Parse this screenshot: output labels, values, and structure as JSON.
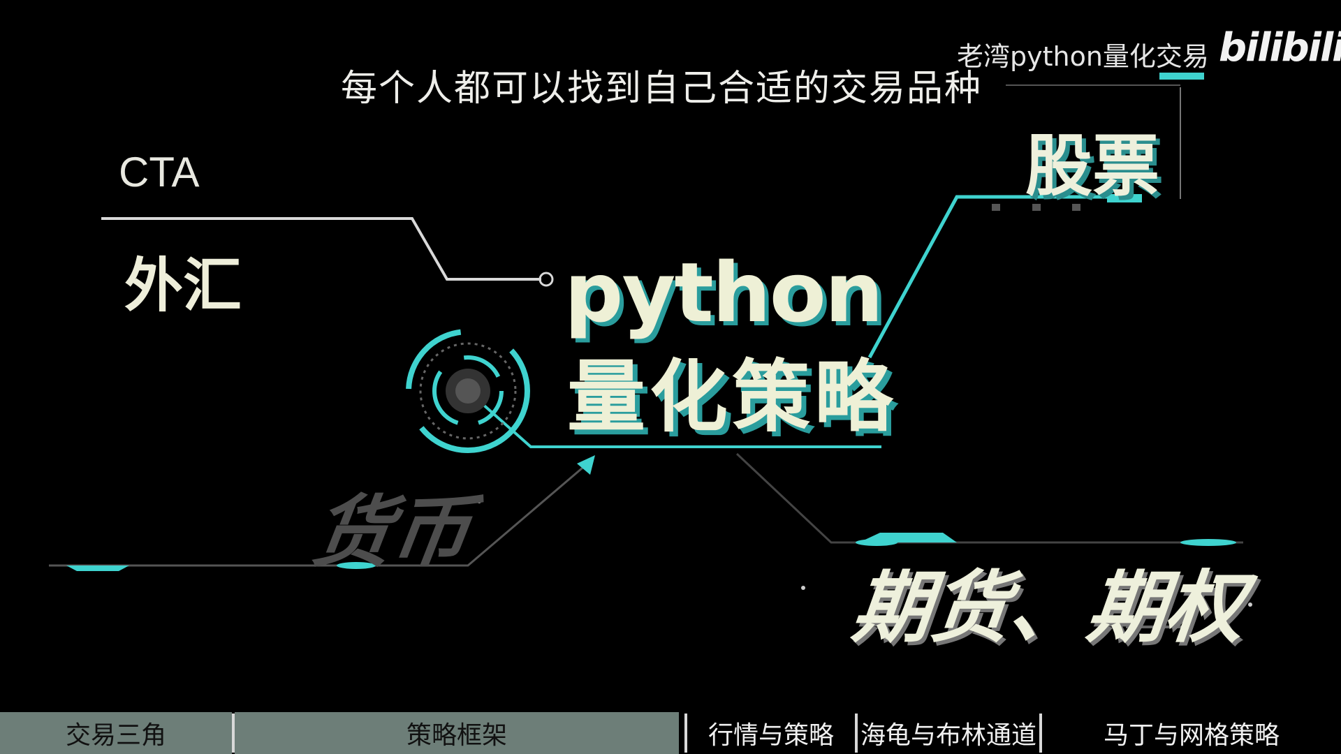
{
  "subtitle": "每个人都可以找到自己合适的交易品种",
  "watermark": {
    "text": "老湾python量化交易",
    "logo": "bilibili"
  },
  "labels": {
    "cta": "CTA",
    "forex": "外汇",
    "stocks": "股票",
    "title_en": "python",
    "title_cn": "量化策略",
    "currency": "货币",
    "futures_options": "期货、期权"
  },
  "nav": [
    {
      "label": "交易三角",
      "active": true
    },
    {
      "label": "策略框架",
      "active": true
    },
    {
      "label": "行情与策略",
      "active": false
    },
    {
      "label": "海龟与布林通道",
      "active": false
    },
    {
      "label": "马丁与网格策略",
      "active": false
    }
  ],
  "colors": {
    "accent": "#3fd3cf",
    "background": "#000000",
    "nav_active": "#6d7e78"
  }
}
